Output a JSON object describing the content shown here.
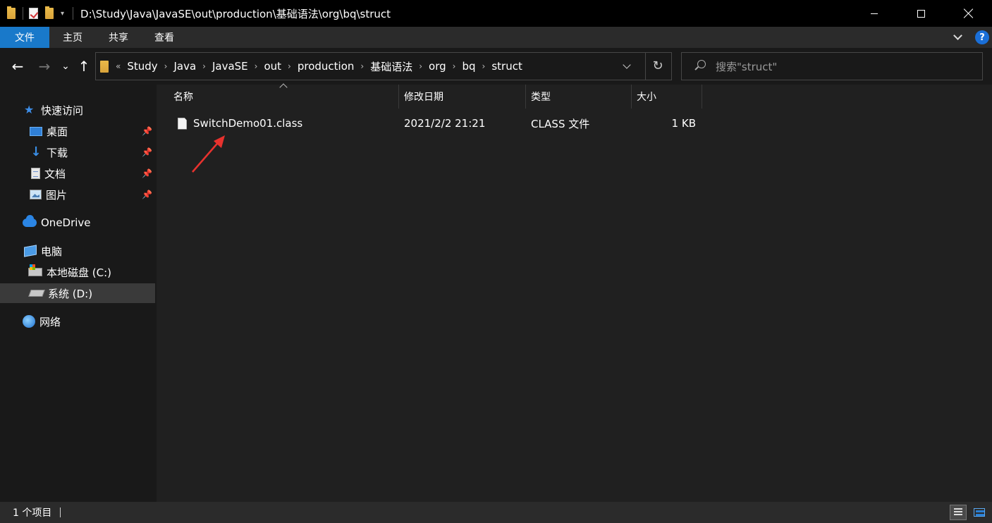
{
  "window": {
    "title": "D:\\Study\\Java\\JavaSE\\out\\production\\基础语法\\org\\bq\\struct"
  },
  "ribbon": {
    "tabs": [
      {
        "label": "文件",
        "active": true
      },
      {
        "label": "主页",
        "active": false
      },
      {
        "label": "共享",
        "active": false
      },
      {
        "label": "查看",
        "active": false
      }
    ],
    "help_label": "?"
  },
  "nav": {
    "back_icon": "←",
    "forward_icon": "→",
    "recent_icon": "⌄",
    "up_icon": "↑",
    "breadcrumb_prefix": "«",
    "breadcrumbs": [
      "Study",
      "Java",
      "JavaSE",
      "out",
      "production",
      "基础语法",
      "org",
      "bq",
      "struct"
    ],
    "refresh_icon": "↻",
    "search_placeholder": "搜索\"struct\""
  },
  "sidebar": {
    "items": [
      {
        "label": "快速访问",
        "icon": "star-icon",
        "pinned": false
      },
      {
        "label": "桌面",
        "icon": "desktop-icon",
        "pinned": true
      },
      {
        "label": "下载",
        "icon": "download-icon",
        "pinned": true
      },
      {
        "label": "文档",
        "icon": "documents-icon",
        "pinned": true
      },
      {
        "label": "图片",
        "icon": "pictures-icon",
        "pinned": true
      },
      {
        "label": "OneDrive",
        "icon": "onedrive-icon",
        "pinned": false
      },
      {
        "label": "电脑",
        "icon": "computer-icon",
        "pinned": false
      },
      {
        "label": "本地磁盘 (C:)",
        "icon": "drive-c-icon",
        "pinned": false
      },
      {
        "label": "系统 (D:)",
        "icon": "drive-d-icon",
        "pinned": false,
        "selected": true
      },
      {
        "label": "网络",
        "icon": "network-icon",
        "pinned": false
      }
    ],
    "pin_glyph": "📌"
  },
  "table": {
    "columns": [
      "名称",
      "修改日期",
      "类型",
      "大小"
    ],
    "rows": [
      {
        "name": "SwitchDemo01.class",
        "modified": "2021/2/2 21:21",
        "type": "CLASS 文件",
        "size": "1 KB"
      }
    ]
  },
  "status": {
    "item_count": "1 个项目"
  },
  "colors": {
    "accent": "#1979ca",
    "annotation_arrow": "#e8322e"
  }
}
